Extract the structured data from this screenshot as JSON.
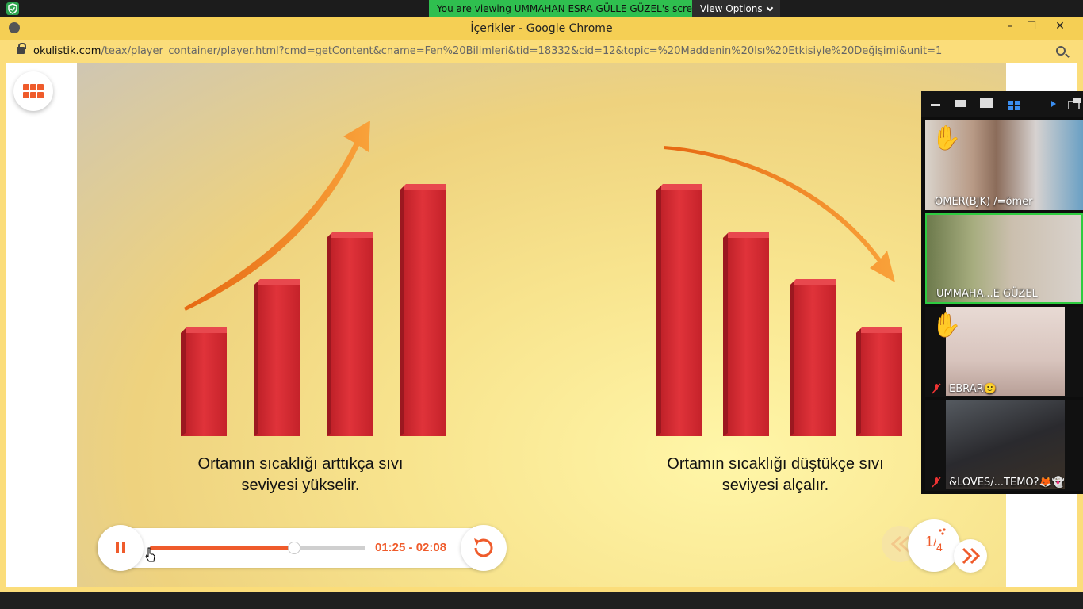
{
  "share_bar": {
    "message": "You are viewing UMMAHAN ESRA GÜLLE GÜZEL's screen",
    "view_options": "View Options"
  },
  "browser": {
    "title": "İçerikler - Google Chrome",
    "minimize": "–",
    "maximize": "☐",
    "close": "✕",
    "url_host": "okulistik.com",
    "url_rest": "/teax/player_container/player.html?cmd=getContent&cname=Fen%20Bilimleri&tid=18332&cid=12&topic=%20Maddenin%20Isı%20Etkisiyle%20Değişimi&unit=1"
  },
  "slide": {
    "left_caption_line1": "Ortamın sıcaklığı arttıkça sıvı",
    "left_caption_line2": "seviyesi yükselir.",
    "right_caption_line1": "Ortamın sıcaklığı düştükçe sıvı",
    "right_caption_line2": "seviyesi alçalır.",
    "left_bars": [
      1,
      2,
      3,
      4
    ],
    "right_bars": [
      4,
      3,
      2,
      1
    ]
  },
  "player": {
    "time": "01:25 - 02:08",
    "progress_fraction": 0.67,
    "page": "1/4",
    "page_num": "1",
    "page_total": "4"
  },
  "participants": [
    {
      "name": "OMER(BJK) /=ömer",
      "hand_raised": true,
      "muted": false,
      "active": false
    },
    {
      "name": "UMMAHA...E GÜZEL",
      "hand_raised": false,
      "muted": false,
      "active": true
    },
    {
      "name": "EBRAR🙂",
      "hand_raised": true,
      "muted": true,
      "active": false
    },
    {
      "name": "&LOVES/...TEMO?🦊👻",
      "hand_raised": false,
      "muted": true,
      "active": false
    }
  ],
  "colors": {
    "accent": "#ef5b2b",
    "bar_red": "#d9262e",
    "arrow_orange": "#f27a1a",
    "active_border": "#2ecc40"
  }
}
